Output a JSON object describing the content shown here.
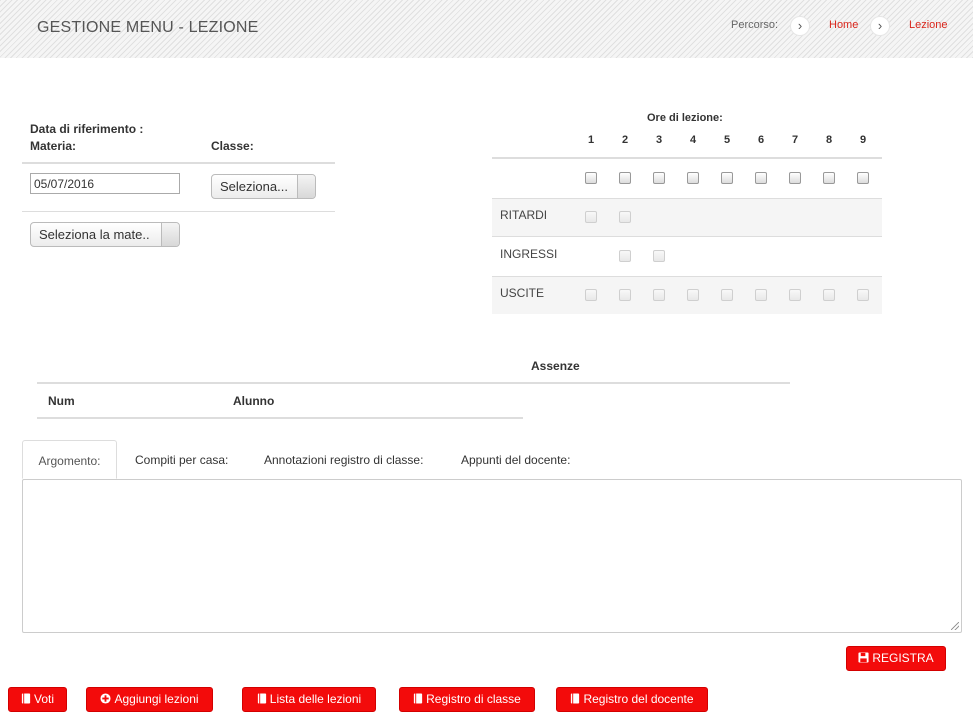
{
  "header": {
    "title": "GESTIONE MENU - LEZIONE",
    "breadcrumb_label": "Percorso:",
    "breadcrumb": [
      "Home",
      "Lezione"
    ]
  },
  "form": {
    "date_label": "Data di riferimento :",
    "subject_label": "Materia:",
    "class_label": "Classe:",
    "date_value": "05/07/2016",
    "class_select": "Seleziona...",
    "subject_select": "Seleziona la mate.."
  },
  "hours": {
    "title": "Ore di lezione:",
    "numbers": [
      "1",
      "2",
      "3",
      "4",
      "5",
      "6",
      "7",
      "8",
      "9"
    ],
    "rows": [
      "RITARDI",
      "INGRESSI",
      "USCITE"
    ]
  },
  "absences": {
    "title": "Assenze",
    "columns": [
      "Num",
      "Alunno"
    ]
  },
  "tabs": [
    "Argomento:",
    "Compiti per casa:",
    "Annotazioni registro di classe:",
    "Appunti del docente:"
  ],
  "buttons": {
    "save": "REGISTRA",
    "voti": "Voti",
    "add_lessons": "Aggiungi lezioni",
    "lesson_list": "Lista delle lezioni",
    "class_register": "Registro di classe",
    "teacher_register": "Registro del docente"
  },
  "colors": {
    "accent": "#f30b0b",
    "link": "#d9261c"
  }
}
